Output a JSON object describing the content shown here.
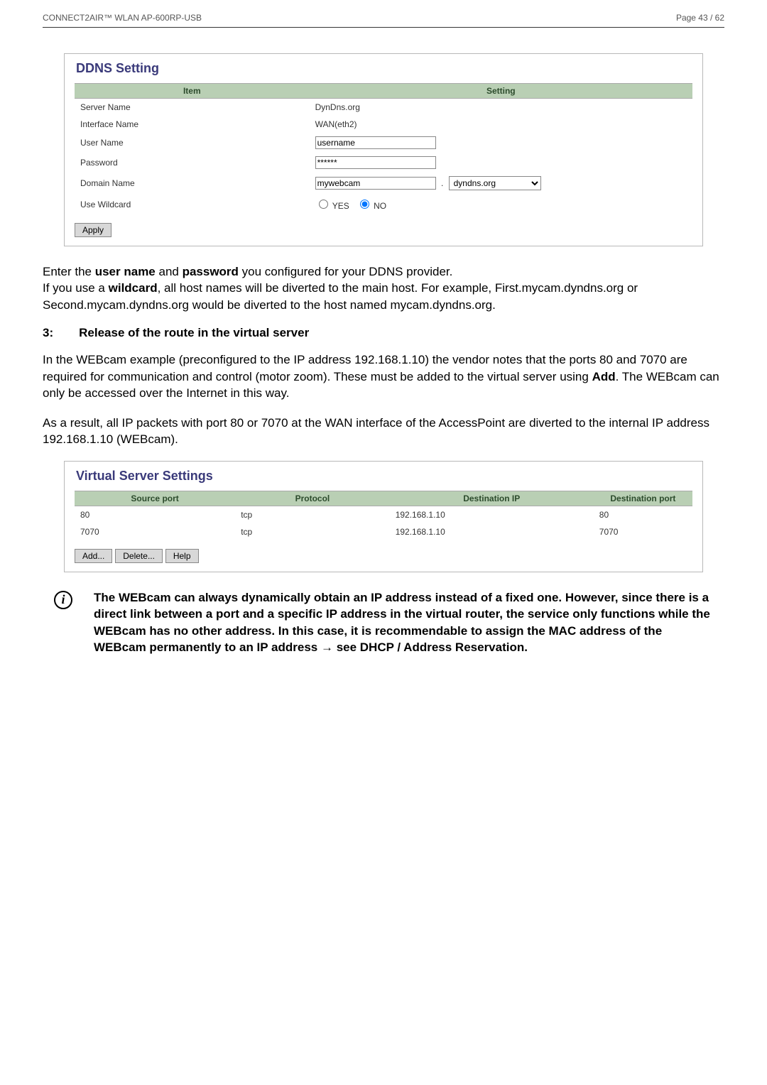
{
  "header": {
    "left": "CONNECT2AIR™ WLAN AP-600RP-USB",
    "right": "Page 43 / 62"
  },
  "ddns": {
    "title": "DDNS Setting",
    "head_item": "Item",
    "head_setting": "Setting",
    "rows": {
      "server_name_label": "Server Name",
      "server_name_value": "DynDns.org",
      "interface_name_label": "Interface Name",
      "interface_name_value": "WAN(eth2)",
      "user_name_label": "User Name",
      "user_name_value": "username",
      "password_label": "Password",
      "password_value": "******",
      "domain_name_label": "Domain Name",
      "domain_name_value": "mywebcam",
      "domain_dot": ".",
      "domain_select": "dyndns.org",
      "use_wildcard_label": "Use Wildcard",
      "yes_label": "YES",
      "no_label": "NO"
    },
    "apply_label": "Apply"
  },
  "para1a": "Enter the ",
  "para1_bold1": "user name",
  "para1b": " and ",
  "para1_bold2": "password",
  "para1c": " you configured for your DDNS provider.",
  "para2a": "If you use a ",
  "para2_bold": "wildcard",
  "para2b": ", all host names will be diverted to the main host. For example, First.mycam.dyndns.org or Second.mycam.dyndns.org would be diverted to the host named mycam.dyndns.org.",
  "heading": {
    "num": "3:",
    "text": "Release of the route in the virtual server"
  },
  "para3a": "In the WEBcam example (preconfigured to the IP address 192.168.1.10) the vendor notes that the ports 80 and 7070 are required for communication and control (motor zoom). These must be added to the virtual server using ",
  "para3_bold": "Add",
  "para3b": ". The WEBcam can only be accessed over the Internet in this way.",
  "para4": "As a result, all IP packets with port 80 or 7070 at the WAN interface of the AccessPoint are diverted to the internal IP address 192.168.1.10 (WEBcam).",
  "vserver": {
    "title": "Virtual Server Settings",
    "head_sp": "Source port",
    "head_prot": "Protocol",
    "head_dip": "Destination IP",
    "head_dp": "Destination port",
    "rows": [
      {
        "sp": "80",
        "prot": "tcp",
        "dip": "192.168.1.10",
        "dp": "80"
      },
      {
        "sp": "7070",
        "prot": "tcp",
        "dip": "192.168.1.10",
        "dp": "7070"
      }
    ],
    "btn_add": "Add...",
    "btn_delete": "Delete...",
    "btn_help": "Help"
  },
  "info_icon": "i",
  "notea": "The WEBcam can always dynamically obtain an IP address instead of a fixed one. However, since there is a direct link between a port and a specific IP address in the virtual router, the service only functions while the WEBcam has no other address. In this case, it is recommendable to assign the MAC address of the WEBcam permanently to an IP address ",
  "arrow": "→",
  "noteb": " see DHCP / Address Reservation."
}
